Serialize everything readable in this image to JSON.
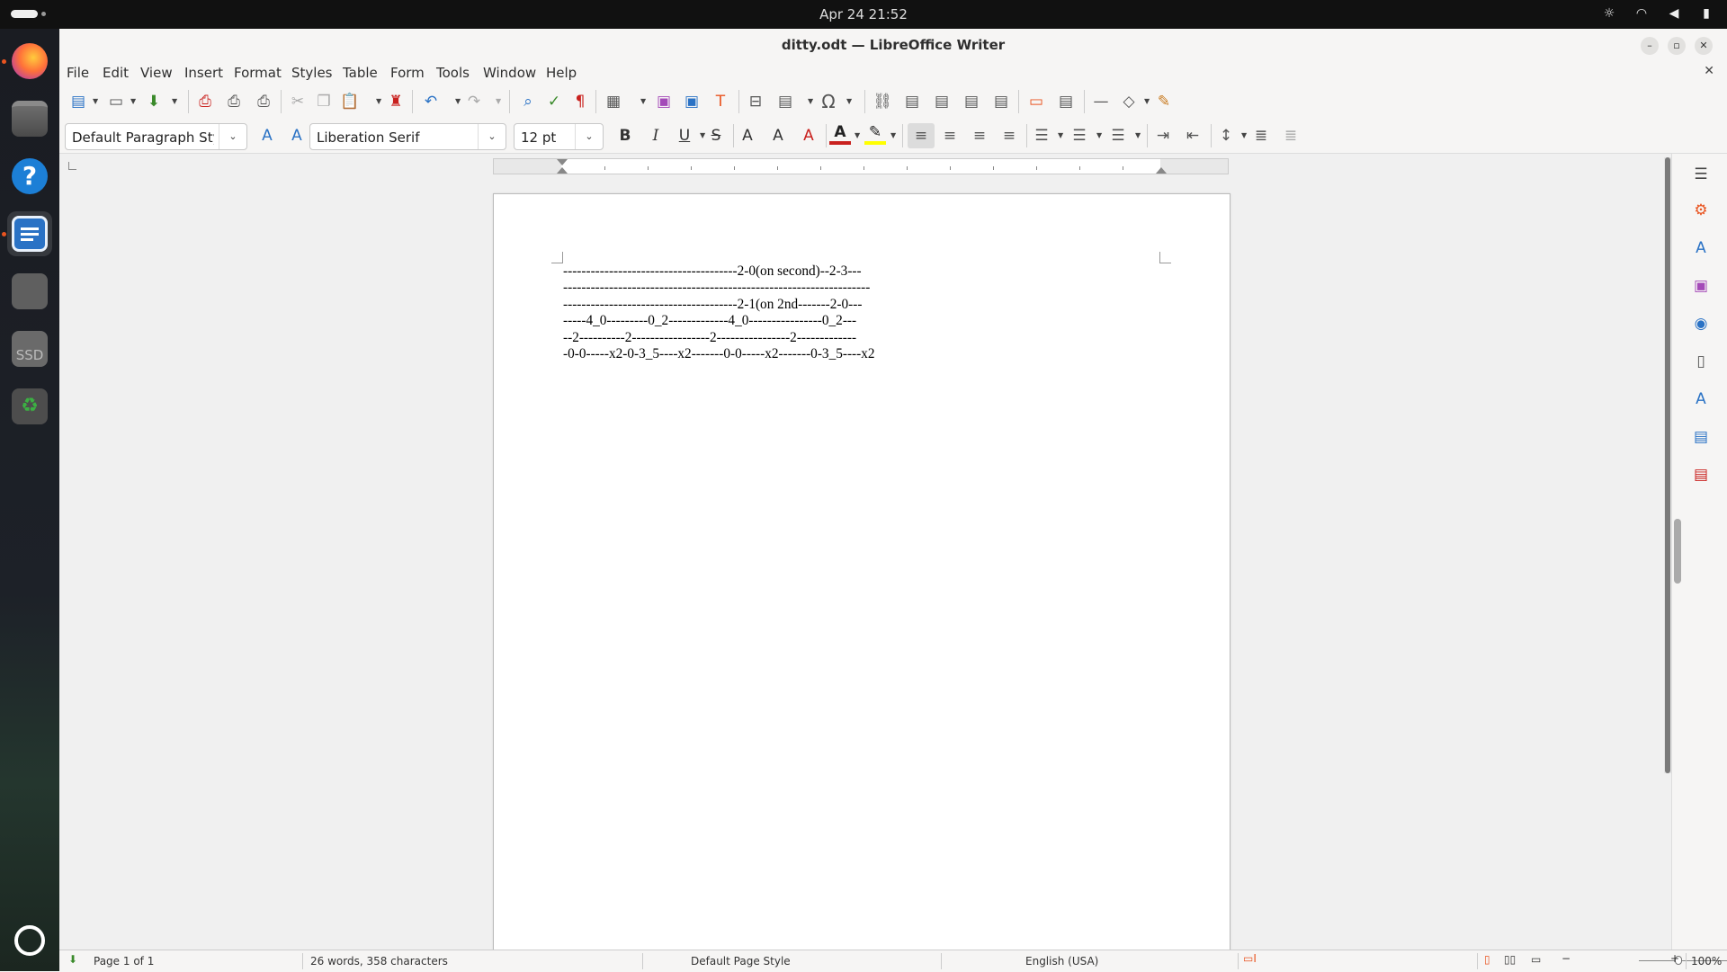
{
  "system": {
    "clock": "Apr 24  21:52",
    "icons": [
      "brightness-icon",
      "wifi-icon",
      "volume-icon",
      "battery-icon"
    ]
  },
  "dock": {
    "apps": [
      "firefox",
      "files",
      "help",
      "libreoffice-writer",
      "text-editor",
      "ssd-drive",
      "trash",
      "show-apps"
    ],
    "ssd_label": "SSD"
  },
  "window": {
    "title": "ditty.odt — LibreOffice Writer"
  },
  "menu": {
    "items": [
      "File",
      "Edit",
      "View",
      "Insert",
      "Format",
      "Styles",
      "Table",
      "Form",
      "Tools",
      "Window",
      "Help"
    ]
  },
  "formatting": {
    "paragraph_style": "Default Paragraph Sty",
    "font_name": "Liberation Serif",
    "font_size": "12 pt"
  },
  "document": {
    "lines": [
      "--------------------------------------2-0(on second)--2-3---",
      "-------------------------------------------------------------------",
      "--------------------------------------2-1(on 2nd-------2-0---",
      "-----4_0---------0_2-------------4_0----------------0_2---",
      "--2----------2-----------------2----------------2-------------",
      "-0-0-----x2-0-3_5----x2-------0-0-----x2-------0-3_5----x2"
    ]
  },
  "status": {
    "page": "Page 1 of 1",
    "word_count": "26 words, 358 characters",
    "page_style": "Default Page Style",
    "language": "English (USA)",
    "zoom": "100%"
  },
  "colors": {
    "accent": "#e95420",
    "font_color": "#c9211e",
    "highlight": "#ffff00"
  }
}
